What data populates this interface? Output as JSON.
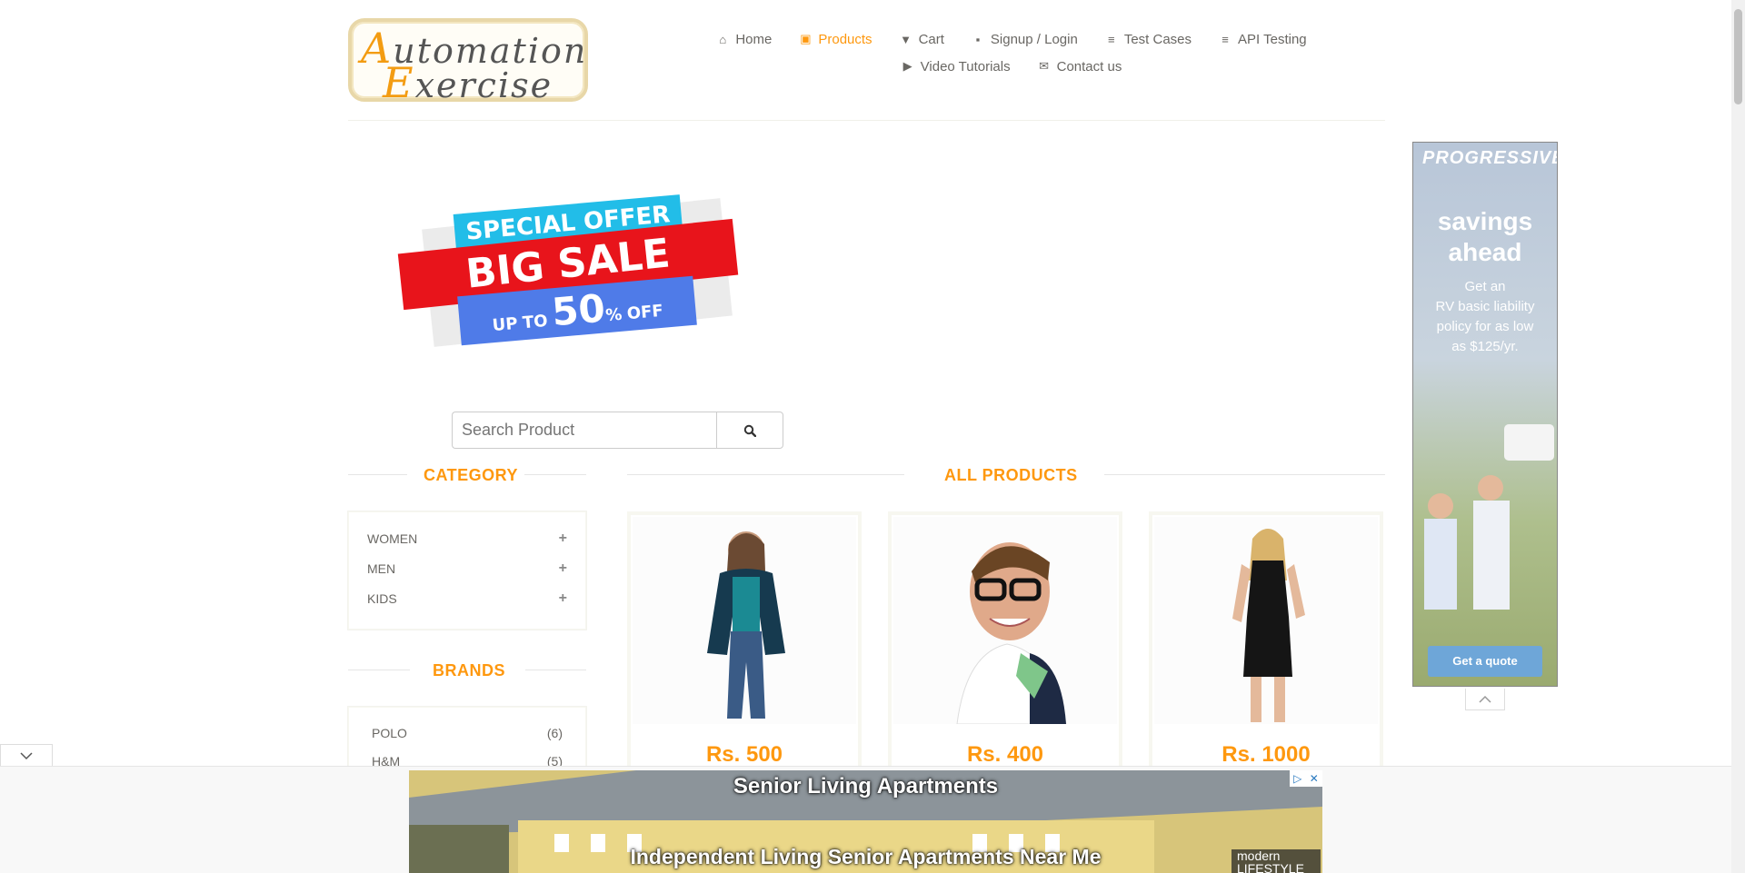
{
  "logo": {
    "line1_cap": "A",
    "line1_rest": "utomation",
    "line2_cap": "E",
    "line2_rest": "xercise"
  },
  "nav": {
    "items": [
      {
        "label": "Home",
        "icon": "home-icon"
      },
      {
        "label": "Products",
        "icon": "briefcase-icon",
        "active": true
      },
      {
        "label": "Cart",
        "icon": "cart-icon"
      },
      {
        "label": "Signup / Login",
        "icon": "lock-icon"
      },
      {
        "label": "Test Cases",
        "icon": "list-icon"
      },
      {
        "label": "API Testing",
        "icon": "list-icon"
      },
      {
        "label": "Video Tutorials",
        "icon": "youtube-icon"
      },
      {
        "label": "Contact us",
        "icon": "envelope-icon"
      }
    ]
  },
  "banner": {
    "line1": "SPECIAL OFFER",
    "line2": "BIG SALE",
    "up": "UP",
    "to": "TO",
    "percent": "50",
    "pct_sign": "%",
    "off": "OFF"
  },
  "search": {
    "placeholder": "Search Product"
  },
  "sidebar": {
    "category_title": "CATEGORY",
    "categories": [
      {
        "label": "WOMEN"
      },
      {
        "label": "MEN"
      },
      {
        "label": "KIDS"
      }
    ],
    "brands_title": "BRANDS",
    "brands": [
      {
        "label": "POLO",
        "count": "(6)"
      },
      {
        "label": "H&M",
        "count": "(5)"
      }
    ]
  },
  "products": {
    "title": "ALL PRODUCTS",
    "items": [
      {
        "price": "Rs. 500"
      },
      {
        "price": "Rs. 400"
      },
      {
        "price": "Rs. 1000"
      }
    ]
  },
  "side_ad": {
    "brand": "PROGRESSIVE",
    "headline_1": "savings",
    "headline_2": "ahead",
    "body_1": "Get an",
    "body_2": "RV basic liability",
    "body_3": "policy for as low",
    "body_4": "as $125/yr.",
    "cta": "Get a quote"
  },
  "bottom_ad": {
    "title": "Senior Living Apartments",
    "subtitle": "Independent Living Senior Apartments Near Me",
    "brand_1": "modern",
    "brand_2": "LIFESTYLE"
  },
  "colors": {
    "accent": "#fe980f",
    "text": "#696763"
  }
}
